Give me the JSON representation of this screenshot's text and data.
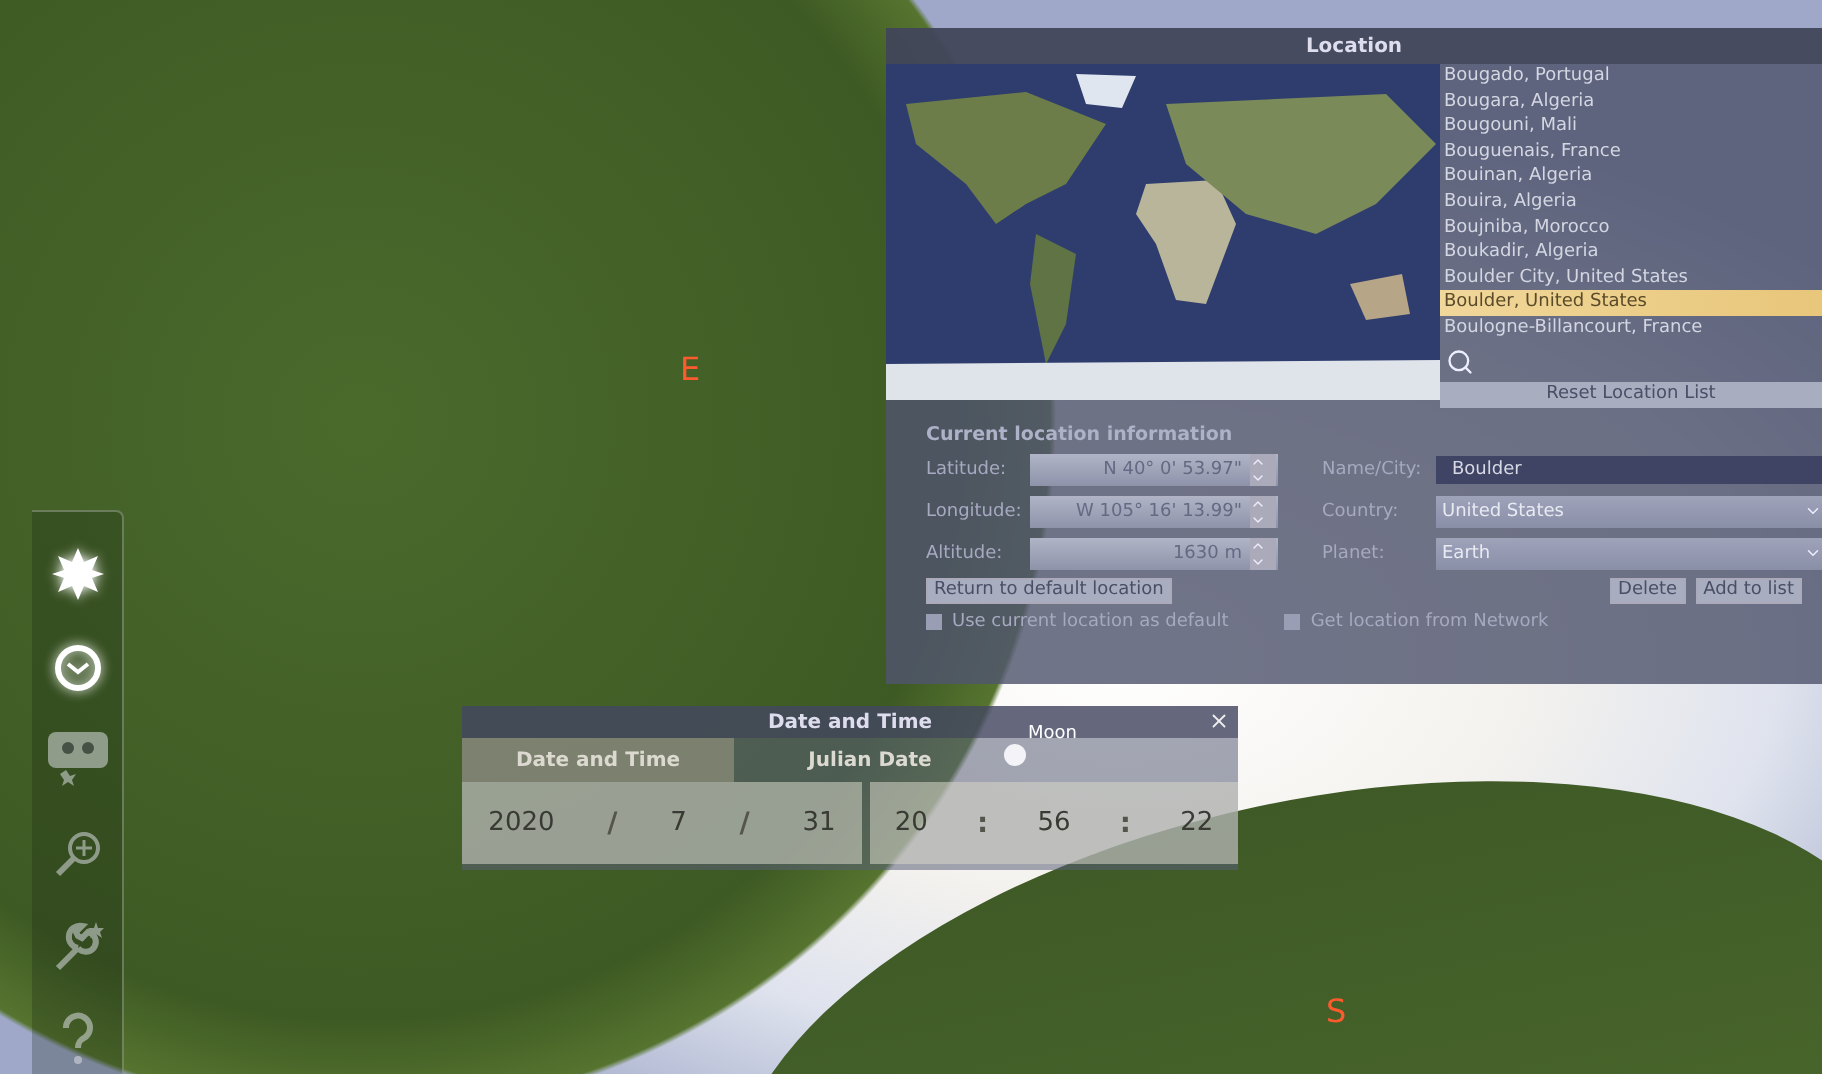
{
  "scene": {
    "cardinal_points": [
      "E",
      "S"
    ],
    "moon_label": "Moon"
  },
  "toolbar": {
    "buttons": [
      {
        "on": true
      },
      {
        "on": true
      },
      {
        "on": false
      },
      {
        "on": false
      },
      {
        "on": false
      },
      {
        "on": false
      }
    ]
  },
  "location_window": {
    "title": "Location",
    "cities": [
      {
        "name": "Bougado, Portugal",
        "selected": false
      },
      {
        "name": "Bougara, Algeria",
        "selected": false
      },
      {
        "name": "Bougouni, Mali",
        "selected": false
      },
      {
        "name": "Bouguenais, France",
        "selected": false
      },
      {
        "name": "Bouinan, Algeria",
        "selected": false
      },
      {
        "name": "Bouira, Algeria",
        "selected": false
      },
      {
        "name": "Boujniba, Morocco",
        "selected": false
      },
      {
        "name": "Boukadir, Algeria",
        "selected": false
      },
      {
        "name": "Boulder City, United States",
        "selected": false
      },
      {
        "name": "Boulder, United States",
        "selected": true
      },
      {
        "name": "Boulogne-Billancourt, France",
        "selected": false
      }
    ],
    "reset_button": "Reset Location List",
    "section_title": "Current location information",
    "coordinates": [
      {
        "label": "Latitude:",
        "value": "N 40° 0' 53.97\""
      },
      {
        "label": "Longitude:",
        "value": "W 105° 16' 13.99\""
      },
      {
        "label": "Altitude:",
        "value": "1630 m"
      }
    ],
    "details": [
      {
        "kind": "text",
        "label": "Name/City:",
        "value": "Boulder"
      },
      {
        "kind": "dropdown",
        "label": "Country:",
        "value": "United States"
      },
      {
        "kind": "dropdown",
        "label": "Planet:",
        "value": "Earth"
      }
    ],
    "default_button": "Return to default location",
    "action_buttons": [
      "Delete",
      "Add to list"
    ],
    "checkboxes": [
      {
        "label": "Use current location as default",
        "checked": false
      },
      {
        "label": "Get location from Network",
        "checked": false
      }
    ]
  },
  "datetime_window": {
    "title": "Date and Time",
    "tabs": [
      {
        "label": "Date and Time",
        "selected": true
      },
      {
        "label": "Julian Date",
        "selected": false
      }
    ],
    "date": [
      {
        "kind": "value",
        "text": "2020"
      },
      {
        "kind": "separator",
        "text": "/"
      },
      {
        "kind": "value",
        "text": "7"
      },
      {
        "kind": "separator",
        "text": "/"
      },
      {
        "kind": "value",
        "text": "31"
      }
    ],
    "time": [
      {
        "kind": "value",
        "text": "20"
      },
      {
        "kind": "separator",
        "text": ":"
      },
      {
        "kind": "value",
        "text": "56"
      },
      {
        "kind": "separator",
        "text": ":"
      },
      {
        "kind": "value",
        "text": "22"
      }
    ]
  }
}
